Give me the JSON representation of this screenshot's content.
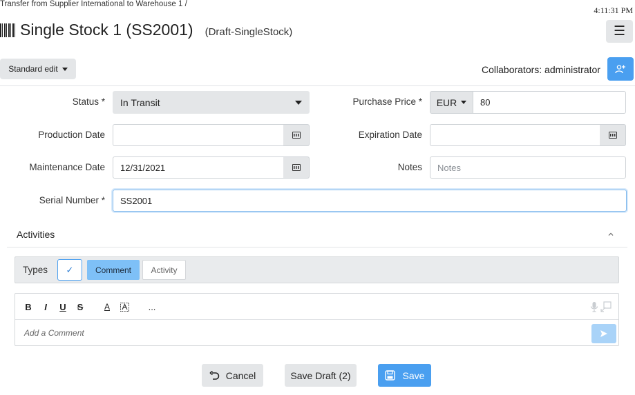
{
  "breadcrumb": "Transfer from Supplier International to Warehouse 1  /",
  "clock": "4:11:31 PM",
  "title": "Single Stock 1 (SS2001)",
  "subtitle": "(Draft-SingleStock)",
  "toolbar": {
    "edit_mode": "Standard edit",
    "collaborators": "Collaborators: administrator"
  },
  "form": {
    "status": {
      "label": "Status *",
      "value": "In Transit"
    },
    "purchase_price": {
      "label": "Purchase Price *",
      "currency": "EUR",
      "value": "80"
    },
    "production_date": {
      "label": "Production Date",
      "value": ""
    },
    "expiration_date": {
      "label": "Expiration Date",
      "value": ""
    },
    "maintenance_date": {
      "label": "Maintenance Date",
      "value": "12/31/2021"
    },
    "notes": {
      "label": "Notes",
      "placeholder": "Notes"
    },
    "serial_number": {
      "label": "Serial Number *",
      "value": "SS2001"
    }
  },
  "activities": {
    "title": "Activities",
    "types_label": "Types",
    "tabs": [
      "Comment",
      "Activity"
    ],
    "editor_tools": {
      "bold": "B",
      "italic": "I",
      "underline": "U",
      "strike": "S",
      "font_color": "A",
      "more": "..."
    },
    "comment_placeholder": "Add a Comment"
  },
  "footer": {
    "cancel": "Cancel",
    "save_draft": "Save Draft (2)",
    "save": "Save"
  },
  "colors": {
    "primary": "#4a9ff0",
    "comment_tab": "#7ec0f7",
    "send_disabled": "#a9d3f8"
  }
}
